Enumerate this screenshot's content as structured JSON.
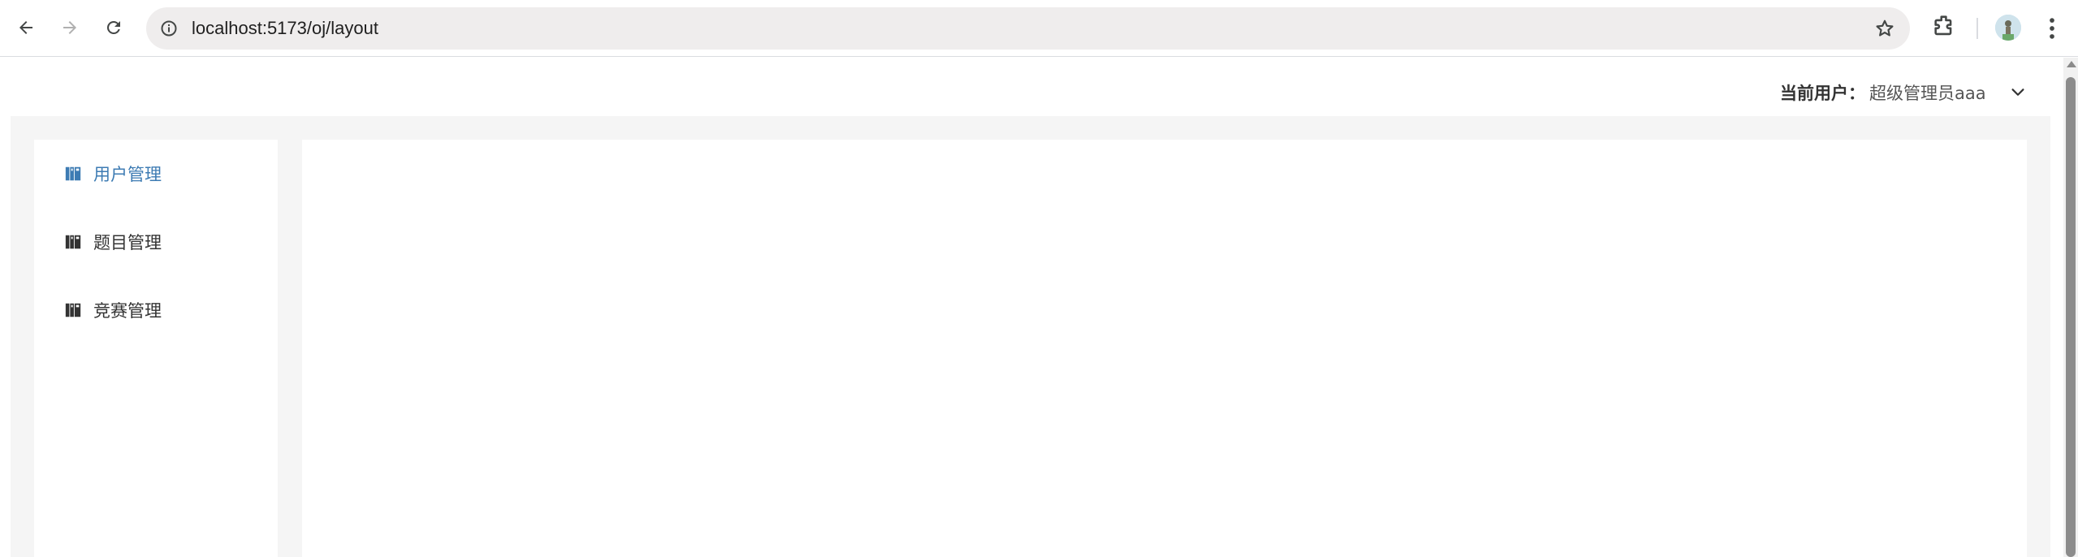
{
  "browser": {
    "url": "localhost:5173/oj/layout"
  },
  "header": {
    "current_user_label": "当前用户：",
    "current_user_name": "超级管理员aaa"
  },
  "sidebar": {
    "items": [
      {
        "label": "用户管理",
        "active": true
      },
      {
        "label": "题目管理",
        "active": false
      },
      {
        "label": "竞赛管理",
        "active": false
      }
    ]
  },
  "colors": {
    "active_menu": "#3d7bb3",
    "menu_text": "#333333",
    "content_bg": "#f5f5f5"
  }
}
